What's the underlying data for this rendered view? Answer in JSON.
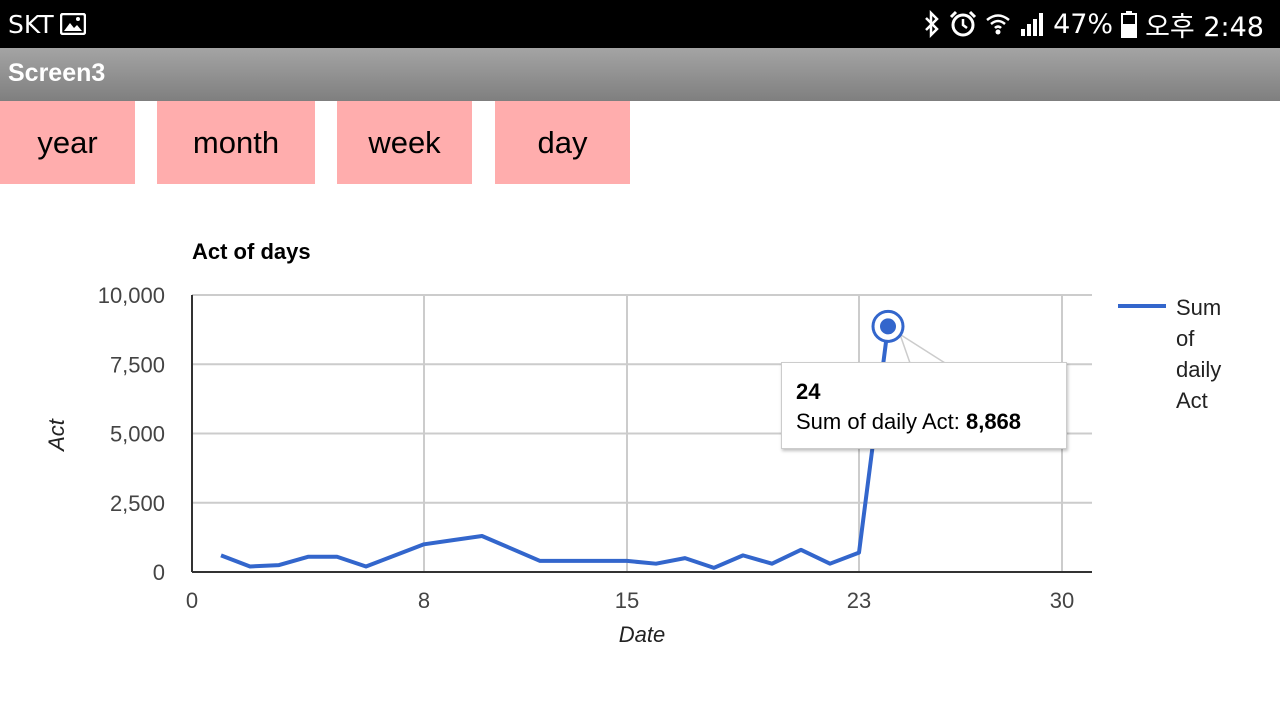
{
  "status_bar": {
    "carrier": "SKT",
    "battery": "47%",
    "time": "오후 2:48",
    "icons": [
      "image-icon",
      "bluetooth-icon",
      "alarm-icon",
      "wifi-icon",
      "signal-icon",
      "battery-icon"
    ]
  },
  "app": {
    "title": "Screen3"
  },
  "tabs": [
    {
      "label": "year"
    },
    {
      "label": "month"
    },
    {
      "label": "week"
    },
    {
      "label": "day"
    }
  ],
  "colors": {
    "tab_bg": "#ffadad",
    "line": "#3366cc",
    "appbar": "#8e8e8e"
  },
  "tooltip": {
    "title": "24",
    "series_label": "Sum of daily Act: ",
    "value": "8,868"
  },
  "chart_data": {
    "type": "line",
    "title": "Act of days",
    "xlabel": "Date",
    "ylabel": "Act",
    "xlim": [
      0,
      30
    ],
    "ylim": [
      0,
      10000
    ],
    "x_ticks": [
      0,
      8,
      15,
      23,
      30
    ],
    "x_tick_labels": [
      "0",
      "8",
      "15",
      "23",
      "30"
    ],
    "y_ticks": [
      0,
      2500,
      5000,
      7500,
      10000
    ],
    "y_tick_labels": [
      "0",
      "2,500",
      "5,000",
      "7,500",
      "10,000"
    ],
    "grid": true,
    "legend_position": "right",
    "series": [
      {
        "name": "Sum of daily Act",
        "legend_lines": [
          "Sum",
          "of",
          "daily",
          "Act"
        ],
        "x": [
          1,
          2,
          3,
          4,
          5,
          6,
          7,
          8,
          9,
          10,
          11,
          12,
          13,
          14,
          15,
          16,
          17,
          18,
          19,
          20,
          21,
          22,
          23,
          24
        ],
        "y": [
          600,
          200,
          250,
          550,
          550,
          200,
          600,
          1000,
          1150,
          1300,
          850,
          400,
          400,
          400,
          400,
          300,
          500,
          150,
          600,
          300,
          800,
          300,
          700,
          8868
        ]
      }
    ],
    "highlighted_point": {
      "x": 24,
      "y": 8868
    }
  }
}
